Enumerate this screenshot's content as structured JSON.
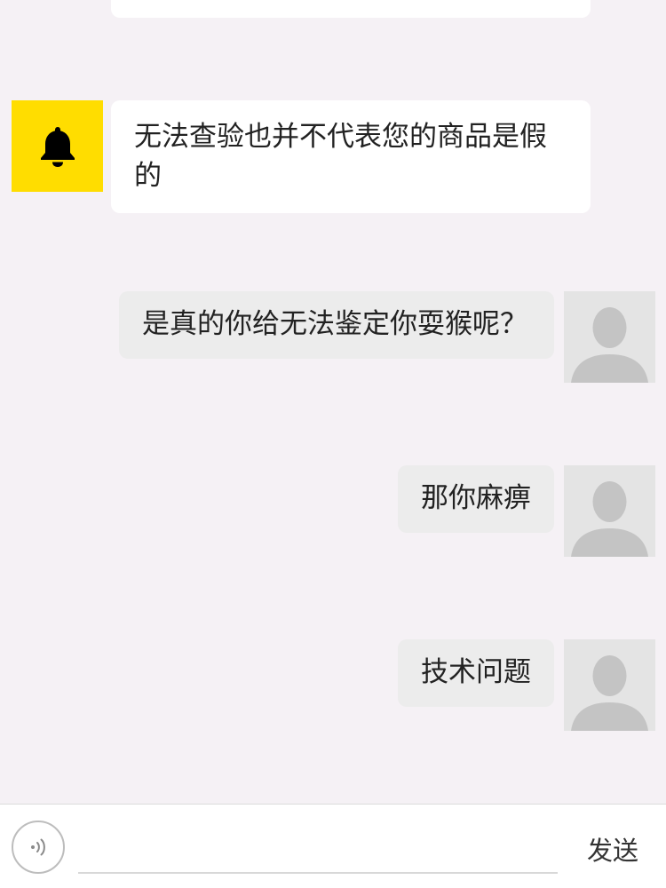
{
  "messages": [
    {
      "sender": "system",
      "avatar_icon": "bell-icon",
      "text": "无法查验也并不代表您的商品是假的"
    },
    {
      "sender": "user",
      "avatar_icon": "default-avatar-icon",
      "text": "是真的你给无法鉴定你耍猴呢？"
    },
    {
      "sender": "user",
      "avatar_icon": "default-avatar-icon",
      "text": "那你麻痹"
    },
    {
      "sender": "user",
      "avatar_icon": "default-avatar-icon",
      "text": "技术问题"
    }
  ],
  "input_bar": {
    "voice_icon": "voice-icon",
    "input_value": "",
    "input_placeholder": "",
    "send_label": "发送"
  },
  "colors": {
    "background": "#f5f1f5",
    "system_avatar": "#ffdd00",
    "incoming_bubble": "#ffffff",
    "outgoing_bubble": "#ececec"
  }
}
